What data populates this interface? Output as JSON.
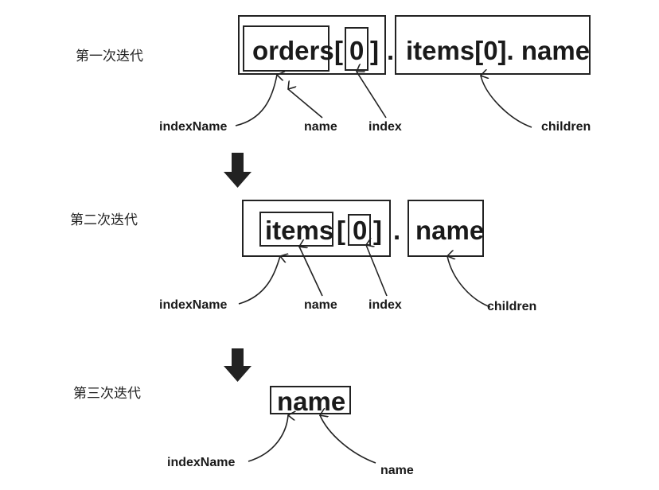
{
  "iterations": [
    {
      "title": "第一次迭代",
      "expr": {
        "name": "orders",
        "open": "[",
        "index": "0",
        "close": "]",
        "dot": ".",
        "children": "items[0]. name"
      },
      "labels": {
        "indexName": "indexName",
        "name": "name",
        "index": "index",
        "children": "children"
      }
    },
    {
      "title": "第二次迭代",
      "expr": {
        "name": "items",
        "open": "[",
        "index": "0",
        "close": "]",
        "dot": ".",
        "children": "name"
      },
      "labels": {
        "indexName": "indexName",
        "name": "name",
        "index": "index",
        "children": "children"
      }
    },
    {
      "title": "第三次迭代",
      "expr": {
        "name": "name"
      },
      "labels": {
        "indexName": "indexName",
        "name": "name"
      }
    }
  ]
}
